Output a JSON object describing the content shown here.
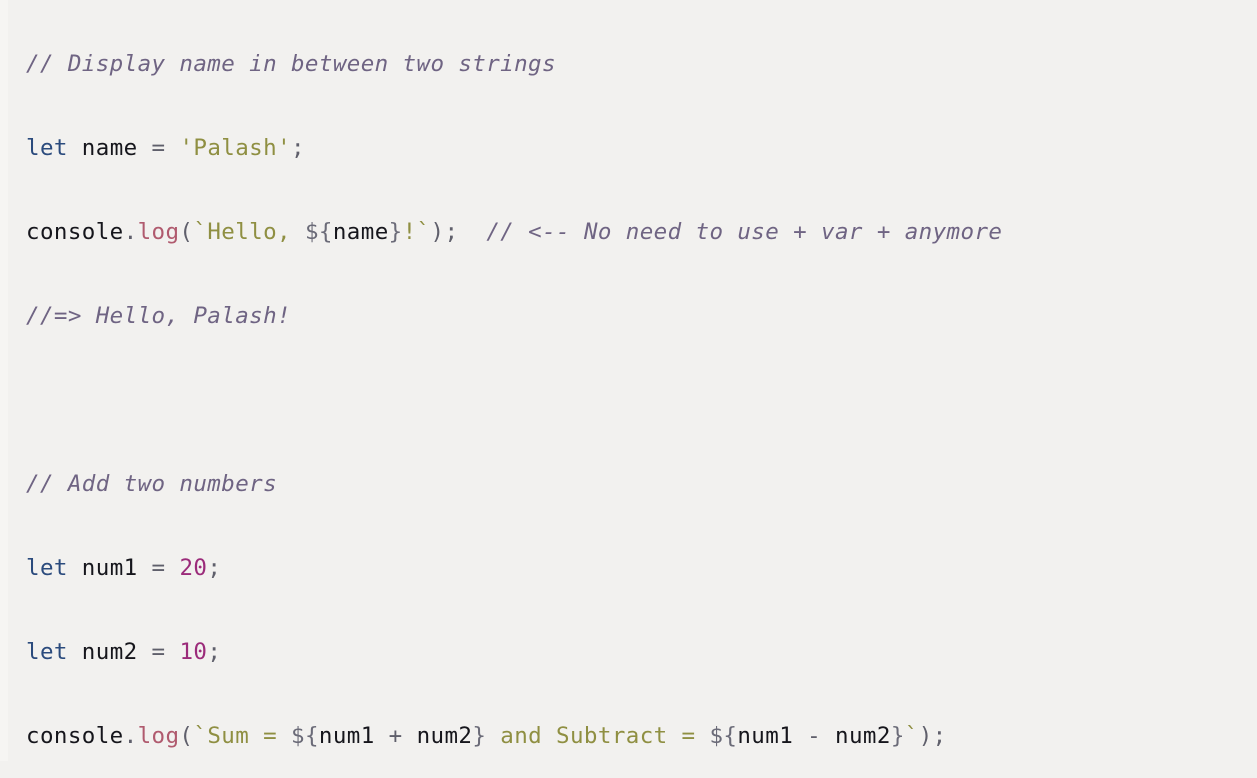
{
  "editor": {
    "language": "javascript",
    "background_color": "#f2f1ef",
    "font_size_px": 22,
    "line_height_px": 84,
    "colors": {
      "comment": "#6f6483",
      "keyword": "#2b4b7d",
      "identifier": "#16161c",
      "method": "#b05a6e",
      "string": "#8f8f42",
      "number": "#9b2b7a",
      "punctuation": "#5f5f6b",
      "interpolation": "#6b6b78"
    }
  },
  "code": {
    "lines": [
      {
        "id": "line-1",
        "kind": "comment",
        "text": "// Display name in between two strings",
        "tokens": [
          {
            "t": "// Display name in between two strings",
            "c": "comment"
          }
        ]
      },
      {
        "id": "line-2",
        "kind": "declaration",
        "text": "let name = 'Palash';",
        "tokens": [
          {
            "t": "let",
            "c": "keyword"
          },
          {
            "t": " ",
            "c": "plain"
          },
          {
            "t": "name",
            "c": "ident"
          },
          {
            "t": " ",
            "c": "plain"
          },
          {
            "t": "=",
            "c": "operator"
          },
          {
            "t": " ",
            "c": "plain"
          },
          {
            "t": "'Palash'",
            "c": "string"
          },
          {
            "t": ";",
            "c": "punct"
          }
        ]
      },
      {
        "id": "line-3",
        "kind": "statement",
        "text": "console.log(`Hello, ${name}!`);  // <-- No need to use + var + anymore",
        "tokens": [
          {
            "t": "console",
            "c": "ident"
          },
          {
            "t": ".",
            "c": "punct"
          },
          {
            "t": "log",
            "c": "method"
          },
          {
            "t": "(",
            "c": "punct"
          },
          {
            "t": "`Hello, ",
            "c": "string"
          },
          {
            "t": "${",
            "c": "interp"
          },
          {
            "t": "name",
            "c": "ident"
          },
          {
            "t": "}",
            "c": "interp"
          },
          {
            "t": "!`",
            "c": "string"
          },
          {
            "t": ");",
            "c": "punct"
          },
          {
            "t": "  ",
            "c": "plain"
          },
          {
            "t": "// <-- No need to use + var + anymore",
            "c": "comment"
          }
        ]
      },
      {
        "id": "line-4",
        "kind": "comment",
        "text": "//=> Hello, Palash!",
        "tokens": [
          {
            "t": "//=> Hello, Palash!",
            "c": "comment"
          }
        ]
      },
      {
        "id": "line-5",
        "kind": "blank",
        "text": "",
        "tokens": []
      },
      {
        "id": "line-6",
        "kind": "comment",
        "text": "// Add two numbers",
        "tokens": [
          {
            "t": "// Add two numbers",
            "c": "comment"
          }
        ]
      },
      {
        "id": "line-7",
        "kind": "declaration",
        "text": "let num1 = 20;",
        "tokens": [
          {
            "t": "let",
            "c": "keyword"
          },
          {
            "t": " ",
            "c": "plain"
          },
          {
            "t": "num1",
            "c": "ident"
          },
          {
            "t": " ",
            "c": "plain"
          },
          {
            "t": "=",
            "c": "operator"
          },
          {
            "t": " ",
            "c": "plain"
          },
          {
            "t": "20",
            "c": "number"
          },
          {
            "t": ";",
            "c": "punct"
          }
        ]
      },
      {
        "id": "line-8",
        "kind": "declaration",
        "text": "let num2 = 10;",
        "tokens": [
          {
            "t": "let",
            "c": "keyword"
          },
          {
            "t": " ",
            "c": "plain"
          },
          {
            "t": "num2",
            "c": "ident"
          },
          {
            "t": " ",
            "c": "plain"
          },
          {
            "t": "=",
            "c": "operator"
          },
          {
            "t": " ",
            "c": "plain"
          },
          {
            "t": "10",
            "c": "number"
          },
          {
            "t": ";",
            "c": "punct"
          }
        ]
      },
      {
        "id": "line-9",
        "kind": "statement",
        "text": "console.log(`Sum = ${num1 + num2} and Subtract = ${num1 - num2}`);",
        "tokens": [
          {
            "t": "console",
            "c": "ident"
          },
          {
            "t": ".",
            "c": "punct"
          },
          {
            "t": "log",
            "c": "method"
          },
          {
            "t": "(",
            "c": "punct"
          },
          {
            "t": "`Sum = ",
            "c": "string"
          },
          {
            "t": "${",
            "c": "interp"
          },
          {
            "t": "num1",
            "c": "ident"
          },
          {
            "t": " ",
            "c": "plain"
          },
          {
            "t": "+",
            "c": "operator"
          },
          {
            "t": " ",
            "c": "plain"
          },
          {
            "t": "num2",
            "c": "ident"
          },
          {
            "t": "}",
            "c": "interp"
          },
          {
            "t": " and Subtract = ",
            "c": "string"
          },
          {
            "t": "${",
            "c": "interp"
          },
          {
            "t": "num1",
            "c": "ident"
          },
          {
            "t": " ",
            "c": "plain"
          },
          {
            "t": "-",
            "c": "operator"
          },
          {
            "t": " ",
            "c": "plain"
          },
          {
            "t": "num2",
            "c": "ident"
          },
          {
            "t": "}",
            "c": "interp"
          },
          {
            "t": "`",
            "c": "string"
          },
          {
            "t": ");",
            "c": "punct"
          }
        ]
      }
    ]
  }
}
